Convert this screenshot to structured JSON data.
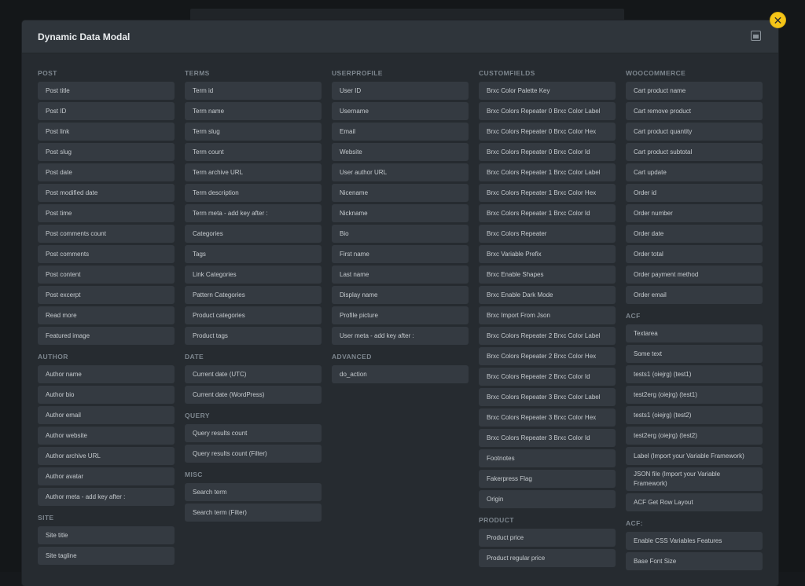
{
  "modal": {
    "title": "Dynamic Data Modal"
  },
  "groups": {
    "post": {
      "title": "POST",
      "items": [
        "Post title",
        "Post ID",
        "Post link",
        "Post slug",
        "Post date",
        "Post modified date",
        "Post time",
        "Post comments count",
        "Post comments",
        "Post content",
        "Post excerpt",
        "Read more",
        "Featured image"
      ]
    },
    "author": {
      "title": "AUTHOR",
      "items": [
        "Author name",
        "Author bio",
        "Author email",
        "Author website",
        "Author archive URL",
        "Author avatar",
        "Author meta - add key after :"
      ]
    },
    "site": {
      "title": "SITE",
      "items": [
        "Site title",
        "Site tagline"
      ]
    },
    "terms": {
      "title": "TERMS",
      "items": [
        "Term id",
        "Term name",
        "Term slug",
        "Term count",
        "Term archive URL",
        "Term description",
        "Term meta - add key after :",
        "Categories",
        "Tags",
        "Link Categories",
        "Pattern Categories",
        "Product categories",
        "Product tags"
      ]
    },
    "date": {
      "title": "DATE",
      "items": [
        "Current date (UTC)",
        "Current date (WordPress)"
      ]
    },
    "query": {
      "title": "QUERY",
      "items": [
        "Query results count",
        "Query results count (Filter)"
      ]
    },
    "misc": {
      "title": "MISC",
      "items": [
        "Search term",
        "Search term (Filter)"
      ]
    },
    "userprofile": {
      "title": "USERPROFILE",
      "items": [
        "User ID",
        "Username",
        "Email",
        "Website",
        "User author URL",
        "Nicename",
        "Nickname",
        "Bio",
        "First name",
        "Last name",
        "Display name",
        "Profile picture",
        "User meta - add key after :"
      ]
    },
    "advanced": {
      "title": "ADVANCED",
      "items": [
        "do_action"
      ]
    },
    "customfields": {
      "title": "CUSTOMFIELDS",
      "items": [
        "Brxc Color Palette Key",
        "Brxc Colors Repeater 0 Brxc Color Label",
        "Brxc Colors Repeater 0 Brxc Color Hex",
        "Brxc Colors Repeater 0 Brxc Color Id",
        "Brxc Colors Repeater 1 Brxc Color Label",
        "Brxc Colors Repeater 1 Brxc Color Hex",
        "Brxc Colors Repeater 1 Brxc Color Id",
        "Brxc Colors Repeater",
        "Brxc Variable Prefix",
        "Brxc Enable Shapes",
        "Brxc Enable Dark Mode",
        "Brxc Import From Json",
        "Brxc Colors Repeater 2 Brxc Color Label",
        "Brxc Colors Repeater 2 Brxc Color Hex",
        "Brxc Colors Repeater 2 Brxc Color Id",
        "Brxc Colors Repeater 3 Brxc Color Label",
        "Brxc Colors Repeater 3 Brxc Color Hex",
        "Brxc Colors Repeater 3 Brxc Color Id",
        "Footnotes",
        "Fakerpress Flag",
        "Origin"
      ]
    },
    "product": {
      "title": "PRODUCT",
      "items": [
        "Product price",
        "Product regular price"
      ]
    },
    "woocommerce": {
      "title": "WOOCOMMERCE",
      "items": [
        "Cart product name",
        "Cart remove product",
        "Cart product quantity",
        "Cart product subtotal",
        "Cart update",
        "Order id",
        "Order number",
        "Order date",
        "Order total",
        "Order payment method",
        "Order email"
      ]
    },
    "acf": {
      "title": "ACF",
      "items": [
        "Textarea",
        "Some text",
        "tests1 (oiejrg) (test1)",
        "test2erg (oiejrg) (test1)",
        "tests1 (oiejrg) (test2)",
        "test2erg (oiejrg) (test2)",
        "Label (Import your Variable Framework)",
        "JSON file (Import your Variable Framework)",
        "ACF Get Row Layout"
      ]
    },
    "acf_options": {
      "title": "ACF:",
      "items": [
        "Enable CSS Variables Features",
        "Base Font Size"
      ]
    }
  },
  "colors": {
    "accent": "#f5c518",
    "modal_bg": "#262b30",
    "item_bg": "#343a41"
  },
  "icons": {
    "close": "close-icon",
    "modal_action": "window-icon"
  }
}
